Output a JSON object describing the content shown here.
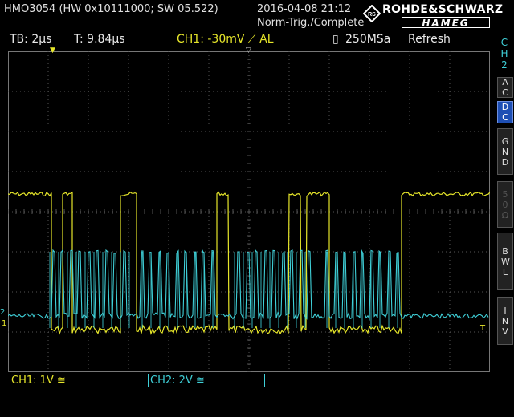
{
  "header": {
    "device": "HMO3054 (HW 0x10111000; SW 05.522)",
    "date": "2016-04-08 21:12",
    "trigger_status": "Norm-Trig./Complete",
    "logo_line1": "ROHDE&SCHWARZ",
    "logo_line2": "HAMEG"
  },
  "info_bar": {
    "timebase": "TB: 2µs",
    "trigger_time": "T: 9.84µs",
    "trigger": "CH1: -30mV ⟋ AL",
    "sample_rate": "250MSa",
    "acq_mode": "Refresh"
  },
  "side_menu": {
    "channel_label": "CH2",
    "buttons": [
      {
        "label": "AC",
        "active": false,
        "enabled": true
      },
      {
        "label": "DC",
        "active": true,
        "enabled": true
      },
      {
        "label": "GND",
        "active": false,
        "enabled": true
      },
      {
        "label": "50Ω",
        "active": false,
        "enabled": false
      },
      {
        "label": "BWL",
        "active": false,
        "enabled": true
      },
      {
        "label": "INV",
        "active": false,
        "enabled": true
      }
    ]
  },
  "footer": {
    "ch1_scale": "CH1: 1V ≅",
    "ch2_scale": "CH2: 2V ≅"
  },
  "colors": {
    "ch1": "#e6e62a",
    "ch2": "#3fd0d8",
    "grid": "#555555",
    "active_button": "#1e4fb4"
  },
  "markers": {
    "ch2_ground": "2",
    "ch1_ground": "1",
    "trigger_position": "T"
  }
}
